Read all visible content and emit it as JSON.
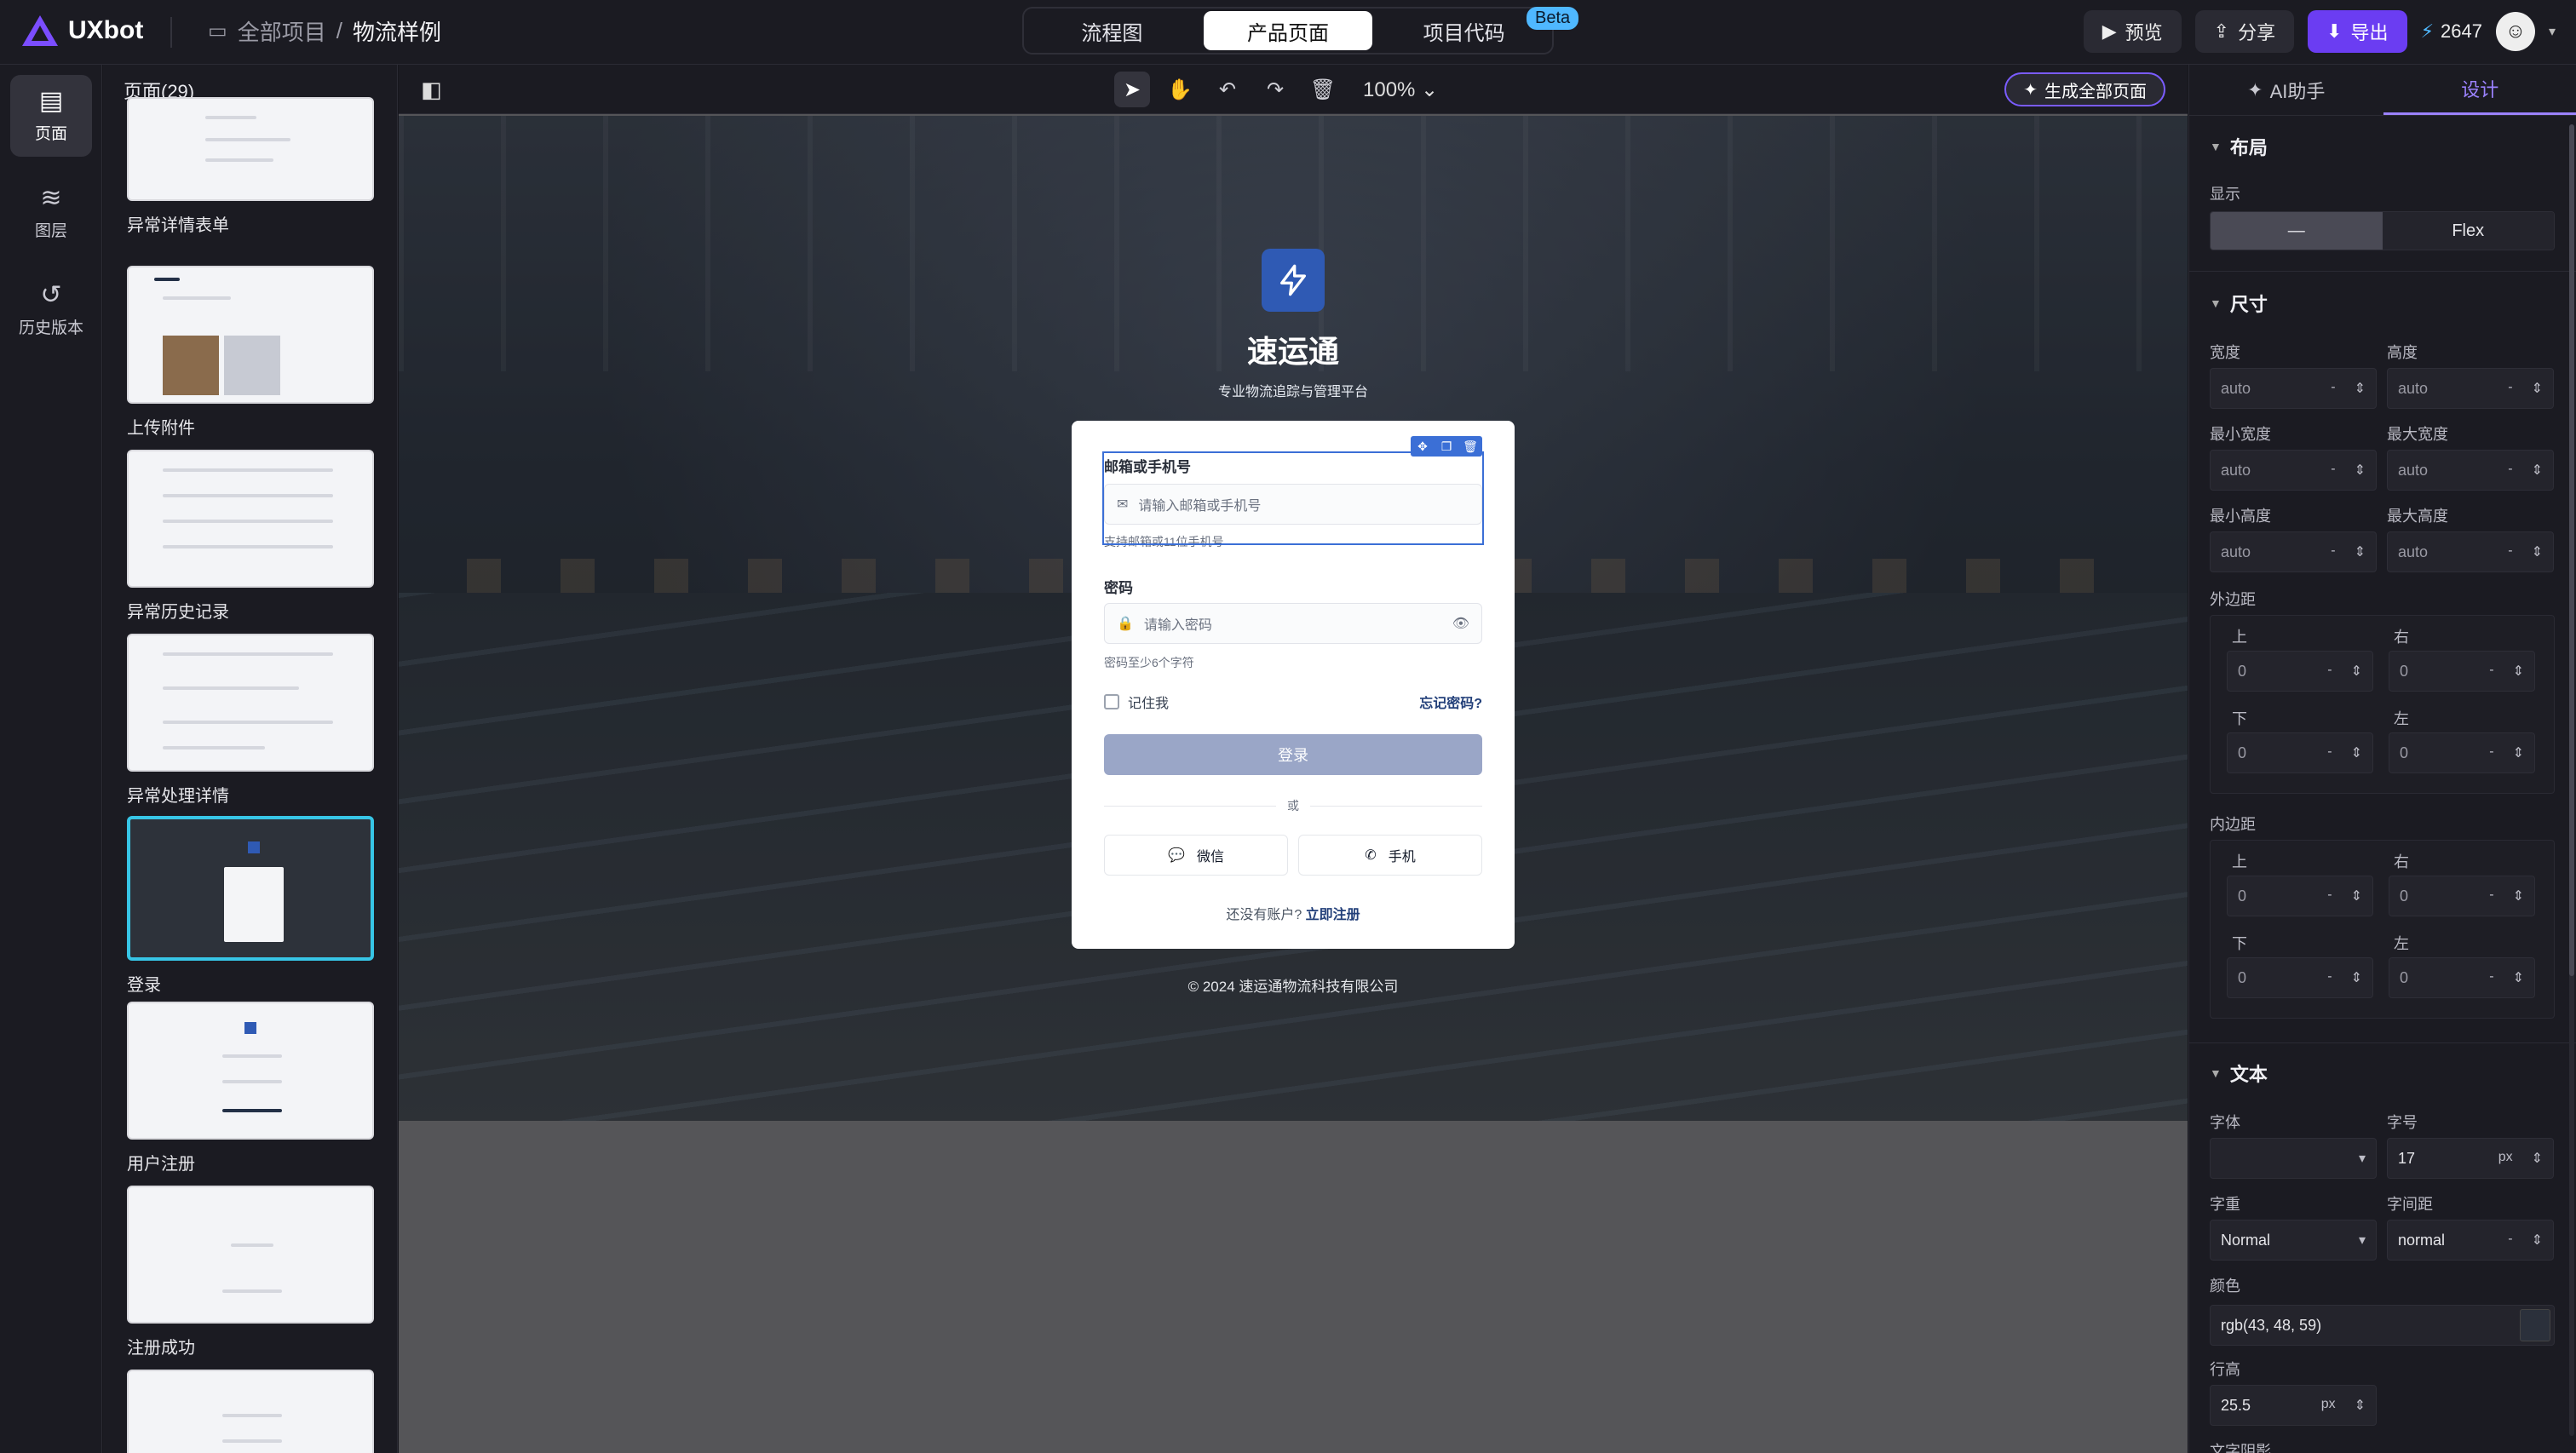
{
  "app": {
    "logo_text": "UXbot",
    "breadcrumb_root": "全部项目",
    "breadcrumb_sep": "/",
    "breadcrumb_current": "物流样例"
  },
  "tabs": [
    {
      "label": "流程图"
    },
    {
      "label": "产品页面",
      "active": true
    },
    {
      "label": "项目代码"
    }
  ],
  "beta_badge": "Beta",
  "toolbar_right": {
    "preview": "预览",
    "share": "分享",
    "export": "导出",
    "credits": "2647"
  },
  "rail": [
    {
      "label": "页面",
      "icon": "layout-icon",
      "active": true
    },
    {
      "label": "图层",
      "icon": "layers-icon"
    },
    {
      "label": "历史版本",
      "icon": "history-icon"
    }
  ],
  "pages_panel": {
    "title": "页面(29)",
    "items": [
      {
        "label": "异常详情表单"
      },
      {
        "label": "上传附件"
      },
      {
        "label": "异常历史记录"
      },
      {
        "label": "异常处理详情"
      },
      {
        "label": "登录",
        "selected": true
      },
      {
        "label": "用户注册"
      },
      {
        "label": "注册成功"
      },
      {
        "label": ""
      }
    ]
  },
  "canvas_toolbar": {
    "zoom": "100%",
    "generate_all": "生成全部页面"
  },
  "login_page": {
    "brand_name": "速运通",
    "brand_subtitle": "专业物流追踪与管理平台",
    "email_label": "邮箱或手机号",
    "email_placeholder": "请输入邮箱或手机号",
    "email_hint": "支持邮箱或11位手机号",
    "password_label": "密码",
    "password_placeholder": "请输入密码",
    "password_hint": "密码至少6个字符",
    "remember_me": "记住我",
    "forgot_password": "忘记密码?",
    "login_button": "登录",
    "or_text": "或",
    "wechat": "微信",
    "phone": "手机",
    "no_account": "还没有账户?",
    "signup_link": "立即注册",
    "copyright": "© 2024 速运通物流科技有限公司"
  },
  "right_panel": {
    "tab_ai": "AI助手",
    "tab_design": "设计",
    "layout_title": "布局",
    "display_label": "显示",
    "display_options": [
      "—",
      "Flex"
    ],
    "size_title": "尺寸",
    "width_label": "宽度",
    "height_label": "高度",
    "min_width_label": "最小宽度",
    "max_width_label": "最大宽度",
    "min_height_label": "最小高度",
    "max_height_label": "最大高度",
    "auto": "auto",
    "dash": "-",
    "margin_label": "外边距",
    "padding_label": "内边距",
    "top": "上",
    "right": "右",
    "bottom": "下",
    "left": "左",
    "zero": "0",
    "text_title": "文本",
    "font_family_label": "字体",
    "font_size_label": "字号",
    "font_size_value": "17",
    "unit_px": "px",
    "font_weight_label": "字重",
    "font_weight_value": "Normal",
    "letter_spacing_label": "字间距",
    "letter_spacing_value": "normal",
    "color_label": "颜色",
    "color_value": "rgb(43, 48, 59)",
    "line_height_label": "行高",
    "line_height_value": "25.5",
    "text_shadow_label": "文字阴影"
  },
  "colors": {
    "accent": "#6b3df2",
    "selection": "#37c5e6",
    "brand_blue": "#2f5ab4"
  }
}
